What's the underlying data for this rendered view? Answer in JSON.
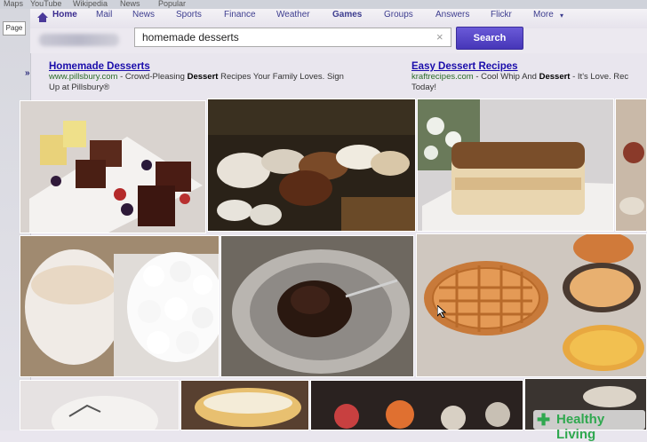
{
  "bookmarks": [
    "Maps",
    "YouTube",
    "Wikipedia",
    "News",
    "Popular"
  ],
  "sidebar": {
    "page_label": "Page"
  },
  "nav": {
    "items": [
      "Home",
      "Mail",
      "News",
      "Sports",
      "Finance",
      "Weather",
      "Games",
      "Groups",
      "Answers",
      "Flickr",
      "More"
    ]
  },
  "search": {
    "query": "homemade desserts",
    "button_label": "Search"
  },
  "ads": [
    {
      "title": "Homemade Desserts",
      "url": "www.pillsbury.com",
      "desc_a": " - Crowd-Pleasing ",
      "bold": "Dessert",
      "desc_b": " Recipes Your Family Loves. Sign",
      "desc_c": "Up at Pillsbury®"
    },
    {
      "title": "Easy Dessert Recipes",
      "url": "kraftrecipes.com",
      "desc_a": " - Cool Whip And ",
      "bold": "Dessert",
      "desc_b": " - It's Love. Rec",
      "desc_c": "Today!"
    }
  ],
  "watermark": "Healthy Living"
}
